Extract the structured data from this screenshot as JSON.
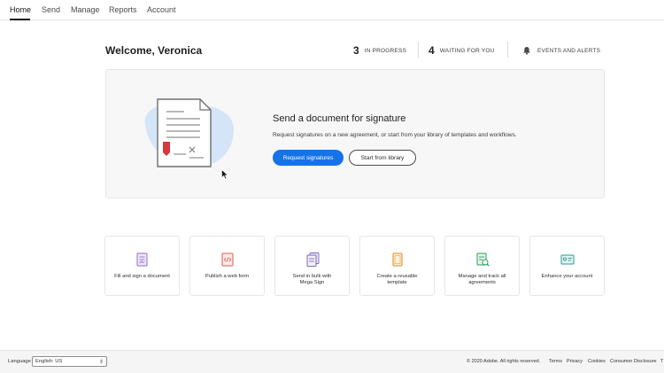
{
  "nav": {
    "tabs": [
      {
        "label": "Home"
      },
      {
        "label": "Send"
      },
      {
        "label": "Manage"
      },
      {
        "label": "Reports"
      },
      {
        "label": "Account"
      }
    ]
  },
  "header": {
    "welcome": "Welcome, Veronica",
    "in_progress_count": "3",
    "in_progress_label": "IN PROGRESS",
    "waiting_count": "4",
    "waiting_label": "WAITING FOR YOU",
    "alerts_label": "EVENTS AND ALERTS"
  },
  "hero": {
    "title": "Send a document for signature",
    "subtitle": "Request signatures on a new agreement, or start from your library of templates and workflows.",
    "primary_label": "Request signatures",
    "secondary_label": "Start from library"
  },
  "cards": [
    {
      "line1": "Fill and sign a document",
      "line2": "",
      "icon": "fill-sign-icon"
    },
    {
      "line1": "Publish a web form",
      "line2": "",
      "icon": "web-form-icon"
    },
    {
      "line1": "Send in bulk with",
      "line2": "Mega Sign",
      "icon": "mega-sign-icon"
    },
    {
      "line1": "Create a reusable",
      "line2": "template",
      "icon": "template-icon"
    },
    {
      "line1": "Manage and track all",
      "line2": "agreements",
      "icon": "manage-track-icon"
    },
    {
      "line1": "Enhance your account",
      "line2": "",
      "icon": "enhance-account-icon"
    }
  ],
  "footer": {
    "language_label": "Language",
    "language_value": "English: US",
    "copyright": "© 2020 Adobe. All rights reserved.",
    "links": [
      "Terms",
      "Privacy",
      "Cookies",
      "Consumer Disclosure",
      "T"
    ]
  },
  "colors": {
    "accent": "#1473e6",
    "signature_red": "#d7373f",
    "blob_blue": "#d5e5f8"
  }
}
